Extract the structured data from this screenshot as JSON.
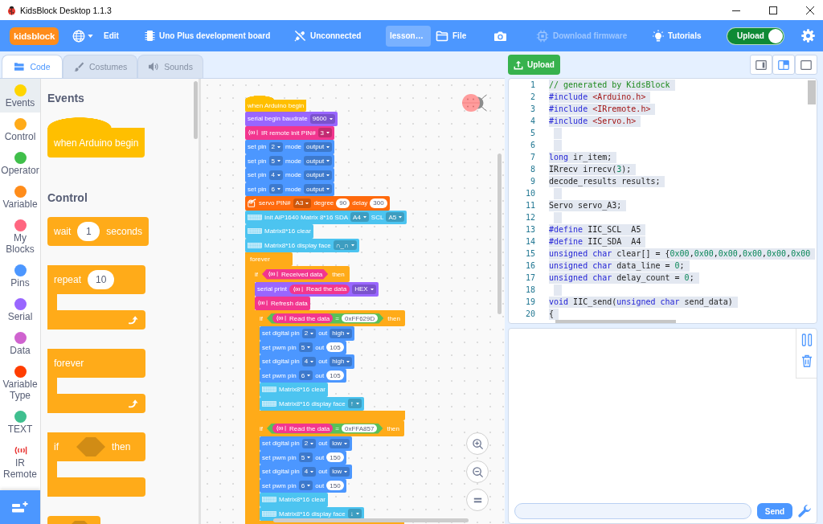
{
  "window": {
    "title": "KidsBlock Desktop 1.1.3"
  },
  "menu_bar": {
    "logo": "kidsblock",
    "edit": "Edit",
    "board": "Uno Plus development board",
    "connection": "Unconnected",
    "project_title": "lesson…",
    "file": "File",
    "firmware": {
      "label": "Download firmware",
      "disabled": true
    },
    "tutorials": "Tutorials",
    "upload_mode": {
      "label": "Upload",
      "on": true
    }
  },
  "tabs": [
    {
      "kind": "code",
      "label": "Code",
      "selected": true
    },
    {
      "kind": "costumes",
      "label": "Costumes",
      "selected": false
    },
    {
      "kind": "sounds",
      "label": "Sounds",
      "selected": false
    }
  ],
  "categories": [
    {
      "kind": "dot",
      "label": "Events",
      "color": "#ffd500",
      "selected": true
    },
    {
      "kind": "dot",
      "label": "Control",
      "color": "#ffab19",
      "selected": false
    },
    {
      "kind": "dot",
      "label": "Operator",
      "color": "#40bf4a",
      "selected": false
    },
    {
      "kind": "dot",
      "label": "Variable",
      "color": "#ff8c1a",
      "selected": false
    },
    {
      "kind": "dot",
      "label": "My Blocks",
      "color": "#ff6680",
      "selected": false
    },
    {
      "kind": "dot",
      "label": "Pins",
      "color": "#4c97ff",
      "selected": false
    },
    {
      "kind": "dot",
      "label": "Serial",
      "color": "#9966ff",
      "selected": false
    },
    {
      "kind": "dot",
      "label": "Data",
      "color": "#cf63cf",
      "selected": false
    },
    {
      "kind": "dot",
      "label": "Variable Type",
      "color": "#ff3d00",
      "selected": false
    },
    {
      "kind": "dot",
      "label": "TEXT",
      "color": "#3fbf8f",
      "selected": false
    },
    {
      "kind": "icon",
      "label": "IR Remote",
      "color": "#e8312f",
      "selected": false
    }
  ],
  "palette": [
    {
      "title": "Events",
      "blocks": [
        {
          "kind": "hat",
          "color": "#ffbf00",
          "parts": [
            {
              "kind": "text",
              "text": "when Arduino begin"
            }
          ]
        }
      ]
    },
    {
      "title": "Control",
      "blocks": [
        {
          "kind": "stack",
          "color": "#ffab19",
          "parts": [
            {
              "kind": "text",
              "text": "wait"
            },
            {
              "kind": "number",
              "text": "1"
            },
            {
              "kind": "text",
              "text": "seconds"
            }
          ]
        },
        {
          "kind": "loop",
          "color": "#ffab19",
          "parts": [
            {
              "kind": "text",
              "text": "repeat"
            },
            {
              "kind": "number",
              "text": "10"
            }
          ]
        },
        {
          "kind": "loop",
          "color": "#ffab19",
          "parts": [
            {
              "kind": "text",
              "text": "forever"
            }
          ]
        },
        {
          "kind": "c",
          "color": "#ffab19",
          "parts": [
            {
              "kind": "text",
              "text": "if"
            },
            {
              "kind": "slot"
            },
            {
              "kind": "text",
              "text": "then"
            }
          ]
        },
        {
          "kind": "stack",
          "color": "#ffab19",
          "parts": [
            {
              "kind": "slot"
            }
          ]
        }
      ]
    }
  ],
  "script": [
    {
      "kind": "hat",
      "color": "#ffbf00",
      "parts": [
        {
          "kind": "text",
          "text": "when Arduino begin"
        }
      ]
    },
    {
      "kind": "stack",
      "color": "#9966ff",
      "parts": [
        {
          "kind": "text",
          "text": "serial begin baudrate"
        },
        {
          "kind": "dropdown",
          "text": "9600"
        }
      ]
    },
    {
      "kind": "stack",
      "color": "#f2368f",
      "parts": [
        {
          "kind": "signal"
        },
        {
          "kind": "text",
          "text": "IR remote init PIN#"
        },
        {
          "kind": "dropdown",
          "text": "3"
        }
      ]
    },
    {
      "kind": "stack",
      "color": "#4c97ff",
      "parts": [
        {
          "kind": "text",
          "text": "set pin"
        },
        {
          "kind": "dropdown",
          "text": "2"
        },
        {
          "kind": "text",
          "text": "mode"
        },
        {
          "kind": "dropdown",
          "text": "output"
        }
      ]
    },
    {
      "kind": "stack",
      "color": "#4c97ff",
      "parts": [
        {
          "kind": "text",
          "text": "set pin"
        },
        {
          "kind": "dropdown",
          "text": "5"
        },
        {
          "kind": "text",
          "text": "mode"
        },
        {
          "kind": "dropdown",
          "text": "output"
        }
      ]
    },
    {
      "kind": "stack",
      "color": "#4c97ff",
      "parts": [
        {
          "kind": "text",
          "text": "set pin"
        },
        {
          "kind": "dropdown",
          "text": "4"
        },
        {
          "kind": "text",
          "text": "mode"
        },
        {
          "kind": "dropdown",
          "text": "output"
        }
      ]
    },
    {
      "kind": "stack",
      "color": "#4c97ff",
      "parts": [
        {
          "kind": "text",
          "text": "set pin"
        },
        {
          "kind": "dropdown",
          "text": "6"
        },
        {
          "kind": "text",
          "text": "mode"
        },
        {
          "kind": "dropdown",
          "text": "output"
        }
      ]
    },
    {
      "kind": "stack",
      "color": "#ff6a0d",
      "parts": [
        {
          "kind": "servo"
        },
        {
          "kind": "text",
          "text": "servo PIN#"
        },
        {
          "kind": "dropdown",
          "text": "A3"
        },
        {
          "kind": "text",
          "text": "degree"
        },
        {
          "kind": "number",
          "text": "90"
        },
        {
          "kind": "text",
          "text": "delay"
        },
        {
          "kind": "number",
          "text": "300"
        }
      ]
    },
    {
      "kind": "stack",
      "color": "#4cc4f0",
      "parts": [
        {
          "kind": "matrix"
        },
        {
          "kind": "text",
          "text": "Init AiP1640 Matrix 8*16 SDA"
        },
        {
          "kind": "dropdown",
          "text": "A4"
        },
        {
          "kind": "text",
          "text": "SCL"
        },
        {
          "kind": "dropdown",
          "text": "A5"
        }
      ]
    },
    {
      "kind": "stack",
      "color": "#4cc4f0",
      "parts": [
        {
          "kind": "matrix"
        },
        {
          "kind": "text",
          "text": "Matrix8*16 clear"
        }
      ]
    },
    {
      "kind": "stack",
      "color": "#4cc4f0",
      "parts": [
        {
          "kind": "matrix"
        },
        {
          "kind": "text",
          "text": "Matrix8*16 display face"
        },
        {
          "kind": "dropdown",
          "text": "∩_∩"
        }
      ]
    },
    {
      "kind": "c",
      "color": "#ffab19",
      "parts": [
        {
          "kind": "text",
          "text": "forever"
        }
      ],
      "children": [
        {
          "kind": "c",
          "color": "#ffab19",
          "parts": [
            {
              "kind": "text",
              "text": "if"
            },
            {
              "kind": "block",
              "block": {
                "kind": "boolean",
                "color": "#f2368f",
                "parts": [
                  {
                    "kind": "signal"
                  },
                  {
                    "kind": "text",
                    "text": "Received data"
                  }
                ]
              }
            },
            {
              "kind": "text",
              "text": "then"
            }
          ],
          "children": [
            {
              "kind": "stack",
              "color": "#9966ff",
              "parts": [
                {
                  "kind": "text",
                  "text": "serial print"
                },
                {
                  "kind": "block",
                  "block": {
                    "kind": "reporter",
                    "color": "#f2368f",
                    "parts": [
                      {
                        "kind": "signal"
                      },
                      {
                        "kind": "text",
                        "text": "Read the data"
                      }
                    ]
                  }
                },
                {
                  "kind": "dropdown",
                  "text": "HEX"
                }
              ]
            },
            {
              "kind": "stack",
              "color": "#f2368f",
              "parts": [
                {
                  "kind": "signal"
                },
                {
                  "kind": "text",
                  "text": "Refresh data"
                }
              ]
            },
            {
              "kind": "c",
              "color": "#ffab19",
              "parts": [
                {
                  "kind": "text",
                  "text": "if"
                },
                {
                  "kind": "block",
                  "block": {
                    "kind": "boolean",
                    "color": "#59c059",
                    "parts": [
                      {
                        "kind": "block",
                        "block": {
                          "kind": "reporter",
                          "color": "#f2368f",
                          "parts": [
                            {
                              "kind": "signal"
                            },
                            {
                              "kind": "text",
                              "text": "Read the data"
                            }
                          ]
                        }
                      },
                      {
                        "kind": "text",
                        "text": "="
                      },
                      {
                        "kind": "number",
                        "text": "0xFF629D"
                      }
                    ]
                  }
                },
                {
                  "kind": "text",
                  "text": "then"
                }
              ],
              "children": [
                {
                  "kind": "stack",
                  "color": "#4c97ff",
                  "parts": [
                    {
                      "kind": "text",
                      "text": "set digital pin"
                    },
                    {
                      "kind": "dropdown",
                      "text": "2"
                    },
                    {
                      "kind": "text",
                      "text": "out"
                    },
                    {
                      "kind": "dropdown",
                      "text": "high"
                    }
                  ]
                },
                {
                  "kind": "stack",
                  "color": "#4c97ff",
                  "parts": [
                    {
                      "kind": "text",
                      "text": "set pwm pin"
                    },
                    {
                      "kind": "dropdown",
                      "text": "5"
                    },
                    {
                      "kind": "text",
                      "text": "out"
                    },
                    {
                      "kind": "number",
                      "text": "105"
                    }
                  ]
                },
                {
                  "kind": "stack",
                  "color": "#4c97ff",
                  "parts": [
                    {
                      "kind": "text",
                      "text": "set digital pin"
                    },
                    {
                      "kind": "dropdown",
                      "text": "4"
                    },
                    {
                      "kind": "text",
                      "text": "out"
                    },
                    {
                      "kind": "dropdown",
                      "text": "high"
                    }
                  ]
                },
                {
                  "kind": "stack",
                  "color": "#4c97ff",
                  "parts": [
                    {
                      "kind": "text",
                      "text": "set pwm pin"
                    },
                    {
                      "kind": "dropdown",
                      "text": "6"
                    },
                    {
                      "kind": "text",
                      "text": "out"
                    },
                    {
                      "kind": "number",
                      "text": "105"
                    }
                  ]
                },
                {
                  "kind": "stack",
                  "color": "#4cc4f0",
                  "parts": [
                    {
                      "kind": "matrix"
                    },
                    {
                      "kind": "text",
                      "text": "Matrix8*16 clear"
                    }
                  ]
                },
                {
                  "kind": "stack",
                  "color": "#4cc4f0",
                  "parts": [
                    {
                      "kind": "matrix"
                    },
                    {
                      "kind": "text",
                      "text": "Matrix8*16 display face"
                    },
                    {
                      "kind": "dropdown",
                      "text": "↑"
                    }
                  ]
                }
              ]
            },
            {
              "kind": "c",
              "color": "#ffab19",
              "parts": [
                {
                  "kind": "text",
                  "text": "if"
                },
                {
                  "kind": "block",
                  "block": {
                    "kind": "boolean",
                    "color": "#59c059",
                    "parts": [
                      {
                        "kind": "block",
                        "block": {
                          "kind": "reporter",
                          "color": "#f2368f",
                          "parts": [
                            {
                              "kind": "signal"
                            },
                            {
                              "kind": "text",
                              "text": "Read the data"
                            }
                          ]
                        }
                      },
                      {
                        "kind": "text",
                        "text": "="
                      },
                      {
                        "kind": "number",
                        "text": "0xFFA857"
                      }
                    ]
                  }
                },
                {
                  "kind": "text",
                  "text": "then"
                }
              ],
              "children": [
                {
                  "kind": "stack",
                  "color": "#4c97ff",
                  "parts": [
                    {
                      "kind": "text",
                      "text": "set digital pin"
                    },
                    {
                      "kind": "dropdown",
                      "text": "2"
                    },
                    {
                      "kind": "text",
                      "text": "out"
                    },
                    {
                      "kind": "dropdown",
                      "text": "low"
                    }
                  ]
                },
                {
                  "kind": "stack",
                  "color": "#4c97ff",
                  "parts": [
                    {
                      "kind": "text",
                      "text": "set pwm pin"
                    },
                    {
                      "kind": "dropdown",
                      "text": "5"
                    },
                    {
                      "kind": "text",
                      "text": "out"
                    },
                    {
                      "kind": "number",
                      "text": "150"
                    }
                  ]
                },
                {
                  "kind": "stack",
                  "color": "#4c97ff",
                  "parts": [
                    {
                      "kind": "text",
                      "text": "set digital pin"
                    },
                    {
                      "kind": "dropdown",
                      "text": "4"
                    },
                    {
                      "kind": "text",
                      "text": "out"
                    },
                    {
                      "kind": "dropdown",
                      "text": "low"
                    }
                  ]
                },
                {
                  "kind": "stack",
                  "color": "#4c97ff",
                  "parts": [
                    {
                      "kind": "text",
                      "text": "set pwm pin"
                    },
                    {
                      "kind": "dropdown",
                      "text": "6"
                    },
                    {
                      "kind": "text",
                      "text": "out"
                    },
                    {
                      "kind": "number",
                      "text": "150"
                    }
                  ]
                },
                {
                  "kind": "stack",
                  "color": "#4cc4f0",
                  "parts": [
                    {
                      "kind": "matrix"
                    },
                    {
                      "kind": "text",
                      "text": "Matrix8*16 clear"
                    }
                  ]
                },
                {
                  "kind": "stack",
                  "color": "#4cc4f0",
                  "parts": [
                    {
                      "kind": "matrix"
                    },
                    {
                      "kind": "text",
                      "text": "Matrix8*16 display face"
                    },
                    {
                      "kind": "dropdown",
                      "text": "↓"
                    }
                  ]
                }
              ]
            }
          ]
        }
      ]
    }
  ],
  "toolbar": {
    "upload_button": "Upload",
    "layout_buttons": [
      {
        "selected": false
      },
      {
        "selected": true
      },
      {
        "selected": false
      }
    ]
  },
  "code_editor": {
    "text_selected": true,
    "lines": [
      {
        "number": "1",
        "tokens": [
          {
            "kind": "comment",
            "text": "// generated by KidsBlock"
          }
        ]
      },
      {
        "number": "2",
        "tokens": [
          {
            "kind": "directive",
            "text": "#include "
          },
          {
            "kind": "string",
            "text": "<Arduino.h>"
          }
        ]
      },
      {
        "number": "3",
        "tokens": [
          {
            "kind": "directive",
            "text": "#include "
          },
          {
            "kind": "string",
            "text": "<IRremote.h>"
          }
        ]
      },
      {
        "number": "4",
        "tokens": [
          {
            "kind": "directive",
            "text": "#include "
          },
          {
            "kind": "string",
            "text": "<Servo.h>"
          }
        ]
      },
      {
        "number": "5"
      },
      {
        "number": "6"
      },
      {
        "number": "7",
        "tokens": [
          {
            "kind": "keyword",
            "text": "long "
          },
          {
            "kind": "plain",
            "text": "ir_item;"
          }
        ]
      },
      {
        "number": "8",
        "tokens": [
          {
            "kind": "plain",
            "text": "IRrecv irrecv("
          },
          {
            "kind": "number",
            "text": "3"
          },
          {
            "kind": "plain",
            "text": ");"
          }
        ]
      },
      {
        "number": "9",
        "tokens": [
          {
            "kind": "plain",
            "text": "decode_results results;"
          }
        ]
      },
      {
        "number": "10"
      },
      {
        "number": "11",
        "tokens": [
          {
            "kind": "plain",
            "text": "Servo servo_A3;"
          }
        ]
      },
      {
        "number": "12"
      },
      {
        "number": "13",
        "tokens": [
          {
            "kind": "directive",
            "text": "#define "
          },
          {
            "kind": "plain",
            "text": "IIC_SCL  A5"
          }
        ]
      },
      {
        "number": "14",
        "tokens": [
          {
            "kind": "directive",
            "text": "#define "
          },
          {
            "kind": "plain",
            "text": "IIC_SDA  A4"
          }
        ]
      },
      {
        "number": "15",
        "tokens": [
          {
            "kind": "keyword",
            "text": "unsigned char "
          },
          {
            "kind": "plain",
            "text": "clear[] = {"
          },
          {
            "kind": "number",
            "text": "0x00"
          },
          {
            "kind": "plain",
            "text": ","
          },
          {
            "kind": "number",
            "text": "0x00"
          },
          {
            "kind": "plain",
            "text": ","
          },
          {
            "kind": "number",
            "text": "0x00"
          },
          {
            "kind": "plain",
            "text": ","
          },
          {
            "kind": "number",
            "text": "0x00"
          },
          {
            "kind": "plain",
            "text": ","
          },
          {
            "kind": "number",
            "text": "0x00"
          },
          {
            "kind": "plain",
            "text": ","
          },
          {
            "kind": "number",
            "text": "0x00"
          }
        ]
      },
      {
        "number": "16",
        "tokens": [
          {
            "kind": "keyword",
            "text": "unsigned char "
          },
          {
            "kind": "plain",
            "text": "data_line = "
          },
          {
            "kind": "number",
            "text": "0"
          },
          {
            "kind": "plain",
            "text": ";"
          }
        ]
      },
      {
        "number": "17",
        "tokens": [
          {
            "kind": "keyword",
            "text": "unsigned char "
          },
          {
            "kind": "plain",
            "text": "delay_count = "
          },
          {
            "kind": "number",
            "text": "0"
          },
          {
            "kind": "plain",
            "text": ";"
          }
        ]
      },
      {
        "number": "18"
      },
      {
        "number": "19",
        "tokens": [
          {
            "kind": "keyword",
            "text": "void "
          },
          {
            "kind": "plain",
            "text": "IIC_send("
          },
          {
            "kind": "keyword",
            "text": "unsigned char "
          },
          {
            "kind": "plain",
            "text": "send_data)"
          }
        ]
      },
      {
        "number": "20",
        "tokens": [
          {
            "kind": "plain",
            "text": "{"
          }
        ]
      }
    ]
  },
  "serial_monitor": {
    "send_button": "Send"
  }
}
